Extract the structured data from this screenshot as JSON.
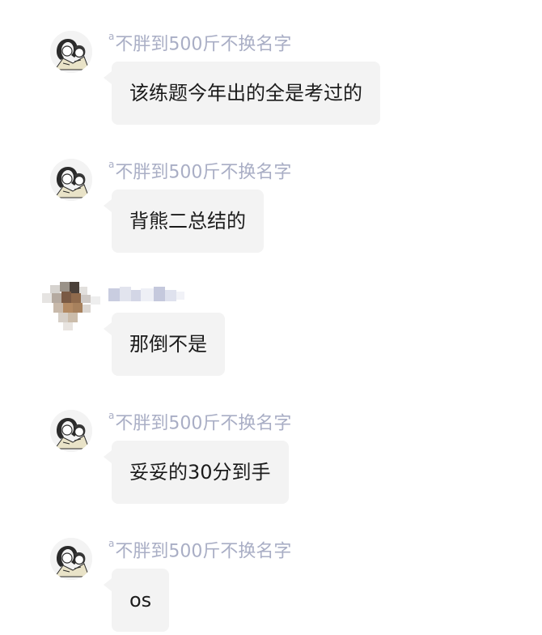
{
  "chat": {
    "messages": [
      {
        "sender": "不胖到500斤不换名字",
        "sender_prefix": "a",
        "text": "该练题今年出的全是考过的",
        "avatar": "cartoon-avatar-icon"
      },
      {
        "sender": "不胖到500斤不换名字",
        "sender_prefix": "a",
        "text": "背熊二总结的",
        "avatar": "cartoon-avatar-icon"
      },
      {
        "sender": "",
        "sender_prefix": "",
        "text": "那倒不是",
        "avatar": "blurred-avatar-icon"
      },
      {
        "sender": "不胖到500斤不换名字",
        "sender_prefix": "a",
        "text": "妥妥的30分到手",
        "avatar": "cartoon-avatar-icon"
      },
      {
        "sender": "不胖到500斤不换名字",
        "sender_prefix": "a",
        "text": "os",
        "avatar": "cartoon-avatar-icon"
      }
    ]
  },
  "colors": {
    "sender_name": "#a9aec5",
    "bubble_bg": "#f3f3f3",
    "text": "#1b1b1b"
  }
}
